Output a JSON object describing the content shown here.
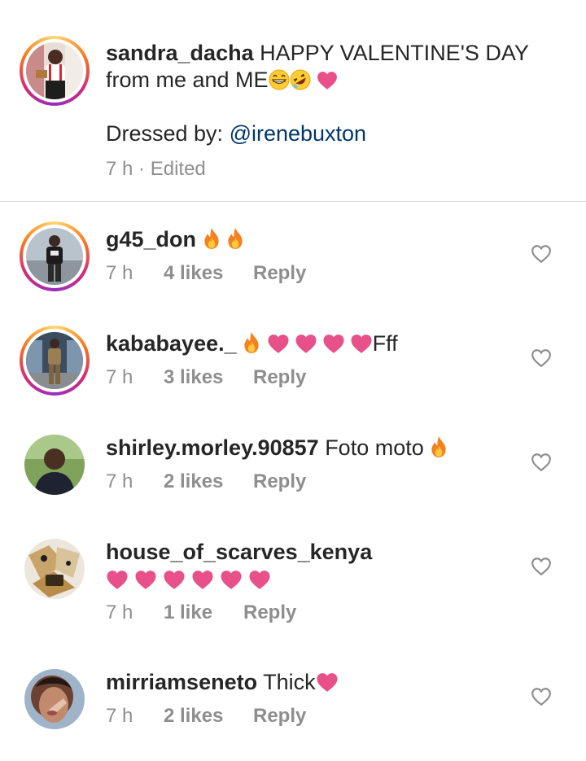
{
  "caption": {
    "username": "sandra_dacha",
    "text_line1": "HAPPY VALENTINE'S DAY",
    "text_line2": "from me and ME",
    "text_line2_emojis": "😁🤣❤",
    "dressed_label": "Dressed by: ",
    "mention": "@irenebuxton",
    "time": "7 h",
    "separator": "·",
    "edited": "Edited"
  },
  "comments": [
    {
      "username": "g45_don",
      "text": "",
      "emojis": "🔥🔥",
      "time": "7 h",
      "likes": "4 likes",
      "reply": "Reply"
    },
    {
      "username": "kababayee._",
      "text": "Fff",
      "emojis": "🔥❤❤❤❤",
      "time": "7 h",
      "likes": "3 likes",
      "reply": "Reply"
    },
    {
      "username": "shirley.morley.90857",
      "text": "Foto moto",
      "emojis": "🔥",
      "time": "7 h",
      "likes": "2 likes",
      "reply": "Reply"
    },
    {
      "username": "house_of_scarves_kenya",
      "text": "",
      "emojis": "❤❤❤❤❤❤",
      "time": "7 h",
      "likes": "1 like",
      "reply": "Reply"
    },
    {
      "username": "mirriamseneto",
      "text": "Thick",
      "emojis": "❤",
      "time": "7 h",
      "likes": "2 likes",
      "reply": "Reply"
    }
  ],
  "colors": {
    "text": "#262626",
    "secondary": "#8e8e8e",
    "mention": "#00376b",
    "heart_emoji": "#e8508a",
    "divider": "#dbdbdb"
  },
  "icons": {
    "like": "heart-outline-icon",
    "fire": "fire-emoji",
    "heart": "heart-emoji"
  }
}
